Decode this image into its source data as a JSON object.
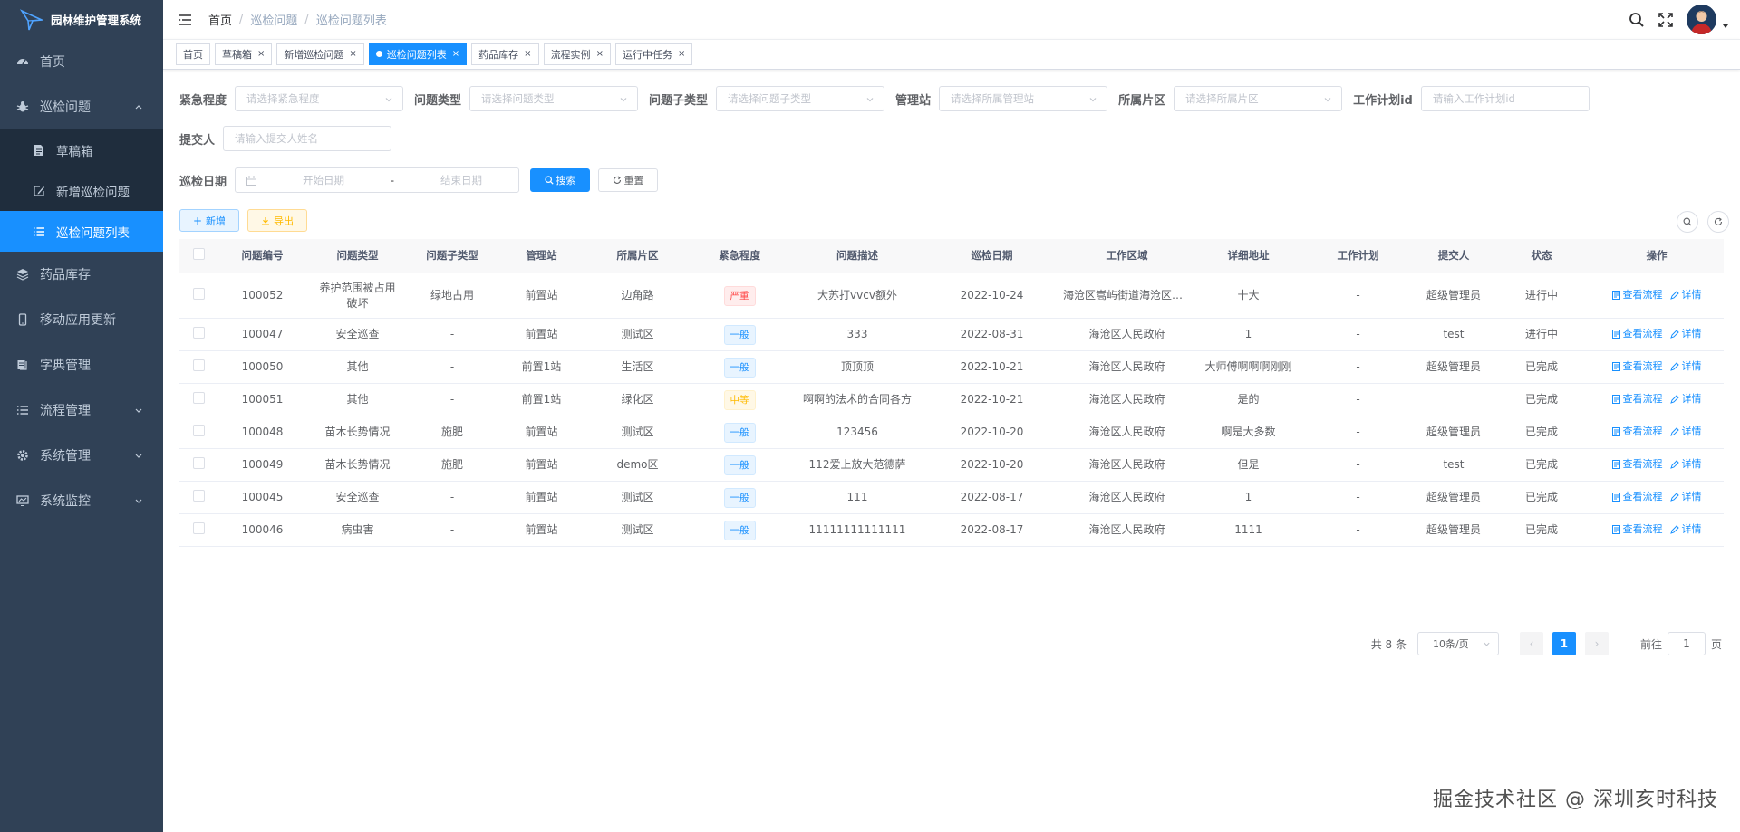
{
  "app": {
    "title": "园林维护管理系统"
  },
  "sidebar": {
    "items": [
      {
        "label": "首页",
        "icon": "dashboard-icon"
      },
      {
        "label": "巡检问题",
        "icon": "bug-icon",
        "expanded": true,
        "children": [
          {
            "label": "草稿箱",
            "icon": "document-icon"
          },
          {
            "label": "新增巡检问题",
            "icon": "edit-icon"
          },
          {
            "label": "巡检问题列表",
            "icon": "list-icon",
            "active": true
          }
        ]
      },
      {
        "label": "药品库存",
        "icon": "database-icon"
      },
      {
        "label": "移动应用更新",
        "icon": "phone-icon"
      },
      {
        "label": "字典管理",
        "icon": "dict-icon"
      },
      {
        "label": "流程管理",
        "icon": "list-icon",
        "has_children": true
      },
      {
        "label": "系统管理",
        "icon": "gear-icon",
        "has_children": true
      },
      {
        "label": "系统监控",
        "icon": "monitor-icon",
        "has_children": true
      }
    ]
  },
  "breadcrumb": [
    "首页",
    "巡检问题",
    "巡检问题列表"
  ],
  "tags": [
    {
      "label": "首页",
      "closable": false
    },
    {
      "label": "草稿箱",
      "closable": true
    },
    {
      "label": "新增巡检问题",
      "closable": true
    },
    {
      "label": "巡检问题列表",
      "closable": true,
      "active": true
    },
    {
      "label": "药品库存",
      "closable": true
    },
    {
      "label": "流程实例",
      "closable": true
    },
    {
      "label": "运行中任务",
      "closable": true
    }
  ],
  "filters": {
    "urgency": {
      "label": "紧急程度",
      "placeholder": "请选择紧急程度"
    },
    "problem_type": {
      "label": "问题类型",
      "placeholder": "请选择问题类型"
    },
    "problem_subtype": {
      "label": "问题子类型",
      "placeholder": "请选择问题子类型"
    },
    "station": {
      "label": "管理站",
      "placeholder": "请选择所属管理站"
    },
    "area": {
      "label": "所属片区",
      "placeholder": "请选择所属片区"
    },
    "plan_id": {
      "label": "工作计划id",
      "placeholder": "请输入工作计划id"
    },
    "submitter": {
      "label": "提交人",
      "placeholder": "请输入提交人姓名"
    },
    "date": {
      "label": "巡检日期",
      "start_placeholder": "开始日期",
      "separator": "-",
      "end_placeholder": "结束日期"
    },
    "search_label": "搜索",
    "reset_label": "重置"
  },
  "toolbar": {
    "add_label": "新增",
    "export_label": "导出"
  },
  "table": {
    "columns": [
      "问题编号",
      "问题类型",
      "问题子类型",
      "管理站",
      "所属片区",
      "紧急程度",
      "问题描述",
      "巡检日期",
      "工作区域",
      "详细地址",
      "工作计划",
      "提交人",
      "状态",
      "操作"
    ],
    "actions": {
      "view_flow": "查看流程",
      "detail": "详情"
    },
    "rows": [
      {
        "id": "100052",
        "type": "养护范围被占用破坏",
        "subtype": "绿地占用",
        "station": "前置站",
        "area": "边角路",
        "urgency": "严重",
        "urgency_level": "severe",
        "desc": "大苏打vvcv额外",
        "date": "2022-10-24",
        "region": "海沧区嵩屿街道海沧区人民政府",
        "address": "十大",
        "plan": "-",
        "submitter": "超级管理员",
        "status": "进行中"
      },
      {
        "id": "100047",
        "type": "安全巡查",
        "subtype": "-",
        "station": "前置站",
        "area": "测试区",
        "urgency": "一般",
        "urgency_level": "normal",
        "desc": "333",
        "date": "2022-08-31",
        "region": "海沧区人民政府",
        "address": "1",
        "plan": "-",
        "submitter": "test",
        "status": "进行中"
      },
      {
        "id": "100050",
        "type": "其他",
        "subtype": "-",
        "station": "前置1站",
        "area": "生活区",
        "urgency": "一般",
        "urgency_level": "normal",
        "desc": "顶顶顶",
        "date": "2022-10-21",
        "region": "海沧区人民政府",
        "address": "大师傅啊啊啊刚刚",
        "plan": "-",
        "submitter": "超级管理员",
        "status": "已完成"
      },
      {
        "id": "100051",
        "type": "其他",
        "subtype": "-",
        "station": "前置1站",
        "area": "绿化区",
        "urgency": "中等",
        "urgency_level": "medium",
        "desc": "啊啊的法术的合同各方",
        "date": "2022-10-21",
        "region": "海沧区人民政府",
        "address": "是的",
        "plan": "-",
        "submitter": "",
        "status": "已完成"
      },
      {
        "id": "100048",
        "type": "苗木长势情况",
        "subtype": "施肥",
        "station": "前置站",
        "area": "测试区",
        "urgency": "一般",
        "urgency_level": "normal",
        "desc": "123456",
        "date": "2022-10-20",
        "region": "海沧区人民政府",
        "address": "啊是大多数",
        "plan": "-",
        "submitter": "超级管理员",
        "status": "已完成"
      },
      {
        "id": "100049",
        "type": "苗木长势情况",
        "subtype": "施肥",
        "station": "前置站",
        "area": "demo区",
        "urgency": "一般",
        "urgency_level": "normal",
        "desc": "112爱上放大范德萨",
        "date": "2022-10-20",
        "region": "海沧区人民政府",
        "address": "但是",
        "plan": "-",
        "submitter": "test",
        "status": "已完成"
      },
      {
        "id": "100045",
        "type": "安全巡查",
        "subtype": "-",
        "station": "前置站",
        "area": "测试区",
        "urgency": "一般",
        "urgency_level": "normal",
        "desc": "111",
        "date": "2022-08-17",
        "region": "海沧区人民政府",
        "address": "1",
        "plan": "-",
        "submitter": "超级管理员",
        "status": "已完成"
      },
      {
        "id": "100046",
        "type": "病虫害",
        "subtype": "-",
        "station": "前置站",
        "area": "测试区",
        "urgency": "一般",
        "urgency_level": "normal",
        "desc": "11111111111111",
        "date": "2022-08-17",
        "region": "海沧区人民政府",
        "address": "1111",
        "plan": "-",
        "submitter": "超级管理员",
        "status": "已完成"
      }
    ]
  },
  "pagination": {
    "total_text": "共 8 条",
    "page_size": "10条/页",
    "current_page": "1",
    "goto_prefix": "前往",
    "goto_value": "1",
    "goto_suffix": "页"
  },
  "watermark": "掘金技术社区 @ 深圳亥时科技",
  "colors": {
    "sidebar": "#304156",
    "submenu": "#1f2d3d",
    "primary": "#1890ff",
    "danger": "#ff4949",
    "warning": "#ffba00"
  }
}
